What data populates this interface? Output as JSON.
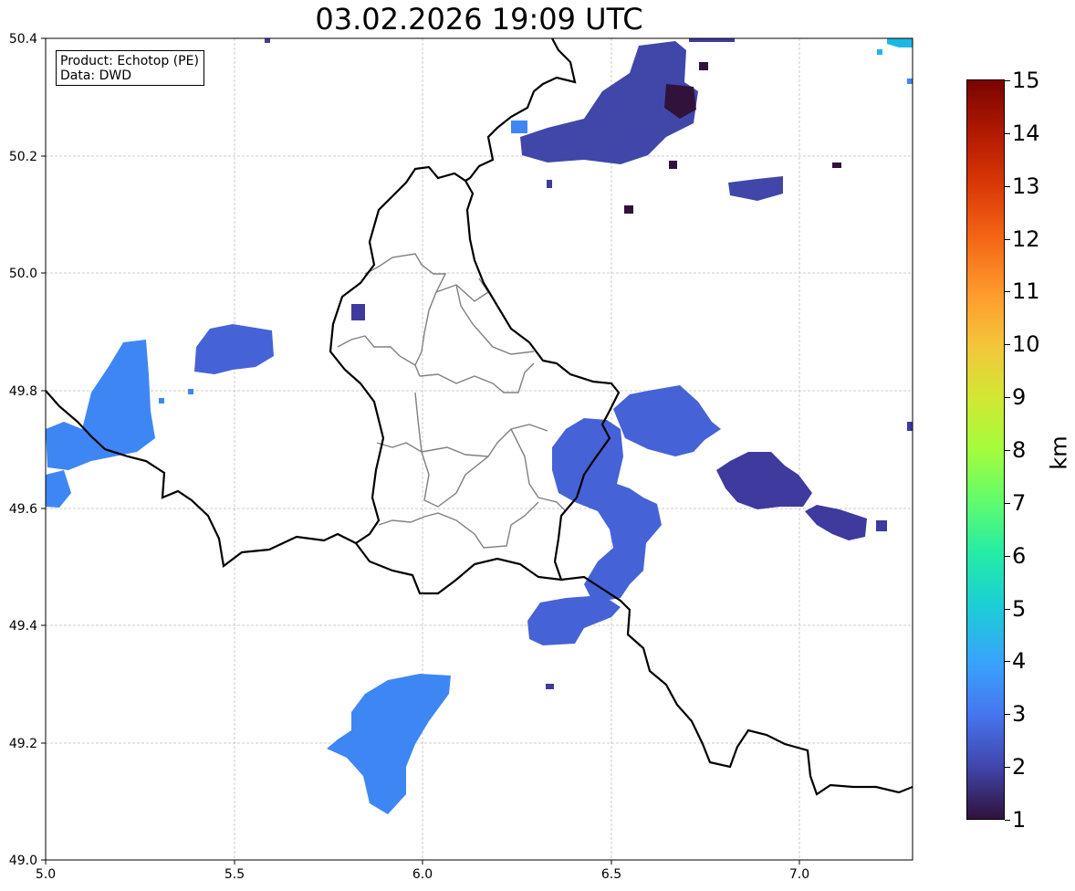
{
  "title": "03.02.2026 19:09 UTC",
  "info": {
    "product": "Product: Echotop (PE)",
    "data": "Data: DWD"
  },
  "map": {
    "lon_range": [
      5.0,
      7.3
    ],
    "lat_range": [
      49.0,
      50.4
    ],
    "x_ticks": [
      "5.0",
      "5.5",
      "6.0",
      "6.5",
      "7.0"
    ],
    "y_ticks": [
      "49.0",
      "49.2",
      "49.4",
      "49.6",
      "49.8",
      "50.0",
      "50.2",
      "50.4"
    ],
    "grid": true,
    "border_color": "#000000",
    "canton_border_color": "#808080"
  },
  "colorbar": {
    "unit": "km",
    "min": 1,
    "max": 15,
    "labels": [
      "15",
      "14",
      "13",
      "12",
      "11",
      "10",
      "9",
      "8",
      "7",
      "6",
      "5",
      "4",
      "3",
      "2",
      "1"
    ],
    "colormap": "turbo"
  },
  "echo_colors": {
    "dark": "#30123b",
    "low": "#3e3a9e",
    "mid": "#4662d7",
    "high": "#3f86f5",
    "cyan": "#1bb8e6"
  }
}
